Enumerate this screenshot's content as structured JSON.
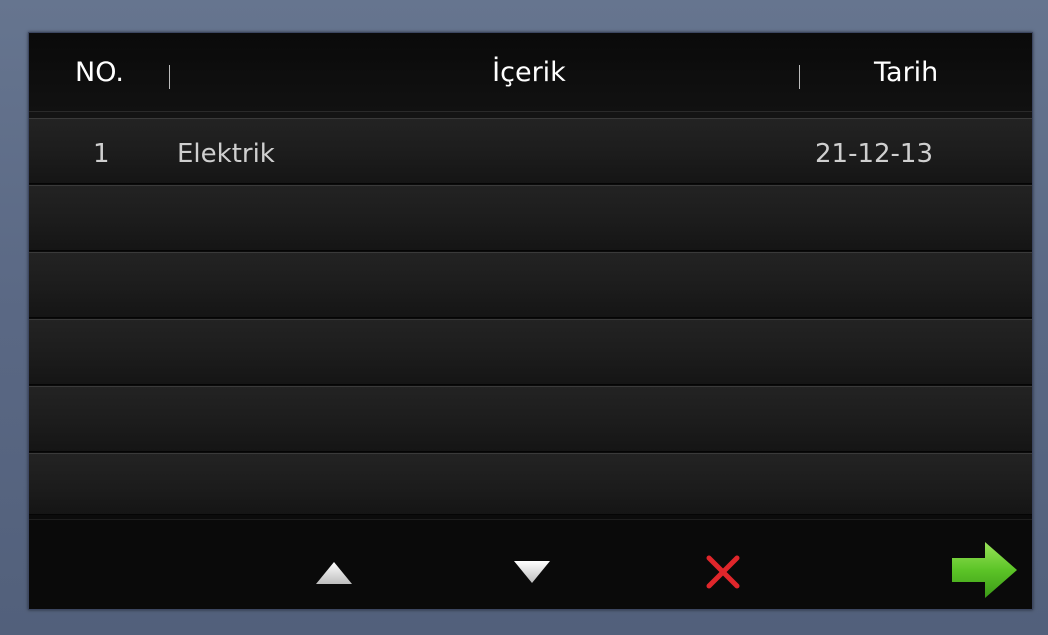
{
  "table": {
    "columns": [
      "NO.",
      "İçerik",
      "Tarih"
    ],
    "rows": [
      {
        "no": "1",
        "content": "Elektrik",
        "date": "21-12-13"
      },
      {
        "no": "",
        "content": "",
        "date": ""
      },
      {
        "no": "",
        "content": "",
        "date": ""
      },
      {
        "no": "",
        "content": "",
        "date": ""
      },
      {
        "no": "",
        "content": "",
        "date": ""
      },
      {
        "no": "",
        "content": "",
        "date": ""
      }
    ]
  },
  "toolbar": {
    "up_icon": "triangle-up-icon",
    "down_icon": "triangle-down-icon",
    "delete_icon": "red-x-icon",
    "next_icon": "green-arrow-right-icon"
  },
  "colors": {
    "frame": "#5b6a86",
    "panel": "#0b0b0b",
    "header_text": "#ffffff",
    "row_text": "#cfcfcf",
    "delete": "#e0262b",
    "next_arrow": "#5cc427"
  }
}
